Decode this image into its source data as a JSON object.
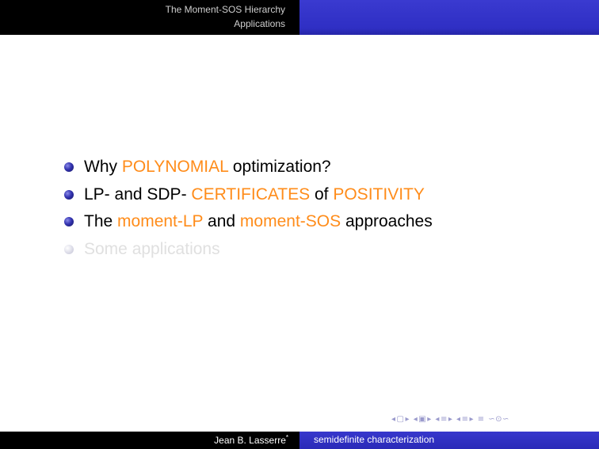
{
  "header": {
    "section": "The Moment-SOS Hierarchy",
    "subsection": "Applications"
  },
  "outline": {
    "items": [
      {
        "parts": [
          {
            "text": "Why ",
            "highlight": false
          },
          {
            "text": "POLYNOMIAL",
            "highlight": true
          },
          {
            "text": " optimization?",
            "highlight": false
          }
        ],
        "dimmed": false
      },
      {
        "parts": [
          {
            "text": "LP- and SDP- ",
            "highlight": false
          },
          {
            "text": "CERTIFICATES",
            "highlight": true
          },
          {
            "text": " of ",
            "highlight": false
          },
          {
            "text": "POSITIVITY",
            "highlight": true
          }
        ],
        "dimmed": false
      },
      {
        "parts": [
          {
            "text": "The ",
            "highlight": false
          },
          {
            "text": "moment-LP",
            "highlight": true
          },
          {
            "text": " and ",
            "highlight": false
          },
          {
            "text": "moment-SOS",
            "highlight": true
          },
          {
            "text": " approaches",
            "highlight": false
          }
        ],
        "dimmed": false
      },
      {
        "parts": [
          {
            "text": "Some applications",
            "highlight": false
          }
        ],
        "dimmed": true
      }
    ]
  },
  "navigation": {
    "icons": [
      "prev-arrow-icon",
      "frame-icon",
      "next-arrow-icon",
      "prev-arrow-icon",
      "subsection-icon",
      "next-arrow-icon",
      "prev-arrow-icon",
      "section-icon",
      "next-arrow-icon",
      "prev-arrow-icon",
      "section-icon",
      "next-arrow-icon",
      "align-icon",
      "search-icon"
    ],
    "glyphs": [
      "◂",
      "▢",
      "▸",
      "◂",
      "▣",
      "▸",
      "◂",
      "≡",
      "▸",
      "◂",
      "≡",
      "▸",
      "≡",
      "∽⊙∽"
    ]
  },
  "footer": {
    "author": "Jean B. Lasserre",
    "author_mark": "*",
    "title": "semidefinite characterization"
  },
  "colors": {
    "highlight": "#ff8c1a",
    "beamer_blue": "#3333cc",
    "header_bg": "#000000"
  }
}
